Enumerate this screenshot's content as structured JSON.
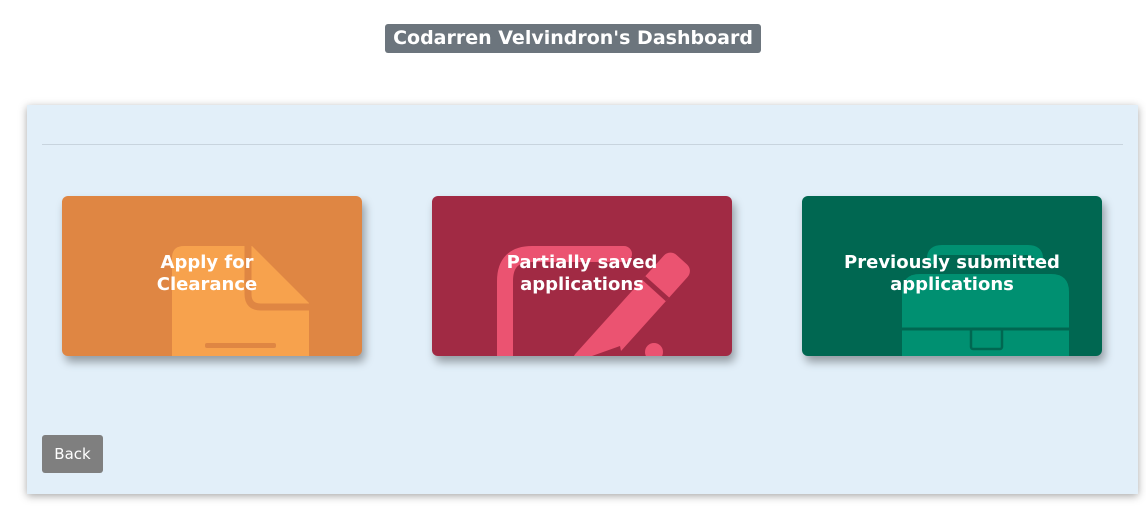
{
  "header": {
    "title": "Codarren Velvindron's Dashboard"
  },
  "tiles": [
    {
      "label": "Apply for\nClearance",
      "icon": "document-icon",
      "color": "#df8643",
      "icon_color": "#f7a24d"
    },
    {
      "label": "Partially saved\napplications",
      "icon": "edit-icon",
      "color": "#a12a44",
      "icon_color": "#eb5371"
    },
    {
      "label": "Previously submitted\napplications",
      "icon": "briefcase-icon",
      "color": "#006751",
      "icon_color": "#009071"
    }
  ],
  "actions": {
    "back_label": "Back"
  }
}
